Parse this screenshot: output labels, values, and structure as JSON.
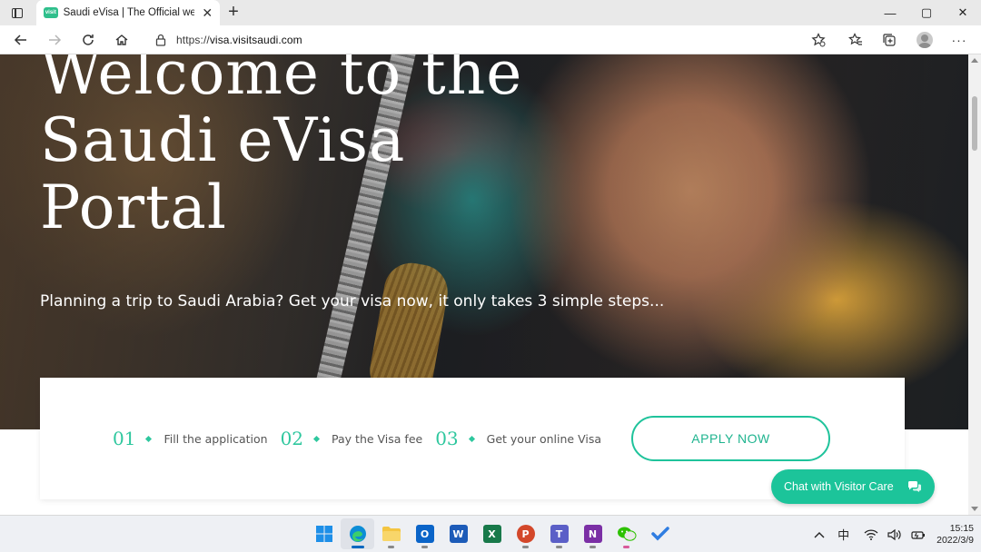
{
  "browser": {
    "tab": {
      "favicon_text": "visit",
      "title": "Saudi eVisa | The Official website",
      "close_glyph": "✕"
    },
    "new_tab_glyph": "+",
    "window_controls": {
      "minimize": "—",
      "maximize": "▢",
      "close": "✕"
    },
    "address": {
      "scheme": "https://",
      "host": "visa.visitsaudi.com"
    },
    "more_glyph": "···"
  },
  "hero": {
    "title_lines": [
      "Welcome to the",
      "Saudi eVisa",
      "Portal"
    ],
    "subtitle": "Planning a trip to Saudi Arabia? Get your visa now, it only takes 3 simple steps..."
  },
  "steps": [
    {
      "number": "01",
      "label": "Fill the application"
    },
    {
      "number": "02",
      "label": "Pay the Visa fee"
    },
    {
      "number": "03",
      "label": "Get your online Visa"
    }
  ],
  "apply_button": "APPLY NOW",
  "chat_button": "Chat with Visitor Care",
  "taskbar": {
    "apps": [
      {
        "name": "start",
        "color": "#1e90ff"
      },
      {
        "name": "edge",
        "color": "#0c8dd6",
        "active": true
      },
      {
        "name": "file-explorer",
        "color": "#f4c542"
      },
      {
        "name": "outlook",
        "color": "#0a64c8",
        "letter": "O"
      },
      {
        "name": "word",
        "color": "#1c5bb8",
        "letter": "W"
      },
      {
        "name": "excel",
        "color": "#18794a",
        "letter": "X"
      },
      {
        "name": "powerpoint",
        "color": "#d3472a",
        "letter": "P"
      },
      {
        "name": "teams",
        "color": "#5b5fc7",
        "letter": "T"
      },
      {
        "name": "onenote",
        "color": "#7b2fa5",
        "letter": "N"
      },
      {
        "name": "wechat",
        "color": "#2dc100"
      },
      {
        "name": "todo",
        "color": "#2f7de1"
      }
    ],
    "tray": {
      "ime": "中",
      "time": "15:15",
      "date": "2022/3/9"
    }
  },
  "colors": {
    "accent": "#1fc39b",
    "step_number": "#2ec79e"
  }
}
